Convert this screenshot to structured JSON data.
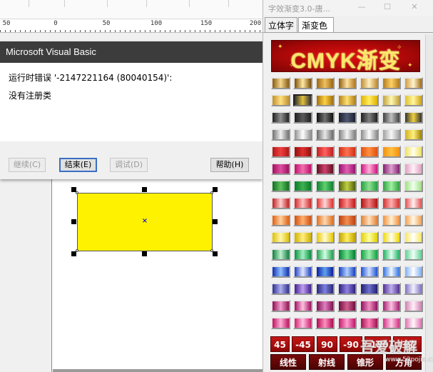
{
  "ruler": {
    "labels": [
      "50",
      "0",
      "50",
      "100",
      "150",
      "200"
    ]
  },
  "vb_dialog": {
    "title": "Microsoft Visual Basic",
    "error_line": "运行时错误 '-2147221164 (80040154)':",
    "error_detail": "没有注册类",
    "buttons": {
      "continue": "继续(C)",
      "end": "结束(E)",
      "debug": "调试(D)",
      "help": "帮助(H)"
    }
  },
  "panel": {
    "title": "字效渐变3.0-唐...",
    "window_controls": {
      "minimize": "—",
      "maximize": "☐",
      "close": "✕"
    },
    "tabs": [
      "立体字",
      "渐变色"
    ],
    "active_tab": "渐变色",
    "banner": "CMYK渐变",
    "angle_buttons": [
      "45",
      "-45",
      "90",
      "-90",
      "-180",
      "归位"
    ],
    "type_buttons": [
      "线性",
      "射线",
      "锥形",
      "方角"
    ]
  },
  "watermark": {
    "text": "吾爱破解",
    "url": "www.52pojie.cn"
  },
  "colors": {
    "selection_fill": "#fff200",
    "vb_titlebar": "#3c3c3c",
    "banner_red": "#c01010",
    "button_red": "#b00d0d"
  },
  "swatch_rows": [
    [
      [
        "#8a5a10",
        "#f5d890",
        "#8a5a10"
      ],
      [
        "#7a4d08",
        "#ffe9a0",
        "#7a4d08"
      ],
      [
        "#9a6612",
        "#f0c060",
        "#9a6612"
      ],
      [
        "#8a5a10",
        "#ffe2a0",
        "#b07820"
      ],
      [
        "#c08a30",
        "#fff0c0",
        "#c08a30"
      ],
      [
        "#b07a20",
        "#ffd060",
        "#b07a20"
      ],
      [
        "#d09a40",
        "#fff5d0",
        "#a06a10"
      ]
    ],
    [
      [
        "#c09030",
        "#ffe080",
        "#c09030"
      ],
      [
        "#303030",
        "#e0c040",
        "#303030"
      ],
      [
        "#a07010",
        "#ffd040",
        "#a07010"
      ],
      [
        "#b08020",
        "#ffe070",
        "#b08020"
      ],
      [
        "#e0b000",
        "#ffee60",
        "#e0b000"
      ],
      [
        "#c0a040",
        "#fff8b0",
        "#c0a040"
      ],
      [
        "#e0c030",
        "#fff6a0",
        "#d0a010"
      ]
    ],
    [
      [
        "#202020",
        "#909090",
        "#202020"
      ],
      [
        "#202020",
        "#5a5a5a",
        "#202020"
      ],
      [
        "#101010",
        "#707070",
        "#101010"
      ],
      [
        "#1a2030",
        "#505870",
        "#1a2030"
      ],
      [
        "#202020",
        "#808080",
        "#202020"
      ],
      [
        "#404040",
        "#c0c0c0",
        "#404040"
      ],
      [
        "#303030",
        "#f0d040",
        "#303030"
      ]
    ],
    [
      [
        "#707070",
        "#f0f0f0",
        "#707070"
      ],
      [
        "#909090",
        "#ffffff",
        "#909090"
      ],
      [
        "#6a6a6a",
        "#e8e8e8",
        "#6a6a6a"
      ],
      [
        "#808080",
        "#f4f4f4",
        "#808080"
      ],
      [
        "#8a8a8a",
        "#ffffff",
        "#8a8a8a"
      ],
      [
        "#a0a0a0",
        "#f8f8f8",
        "#a0a0a0"
      ],
      [
        "#d0b020",
        "#fff080",
        "#a08000"
      ]
    ],
    [
      [
        "#b01818",
        "#f04040",
        "#b01818"
      ],
      [
        "#901010",
        "#e03030",
        "#901010"
      ],
      [
        "#c02020",
        "#ff6060",
        "#c02020"
      ],
      [
        "#d03018",
        "#ff7050",
        "#d03018"
      ],
      [
        "#e05010",
        "#ff9040",
        "#e05010"
      ],
      [
        "#f09010",
        "#ffc040",
        "#f09010"
      ],
      [
        "#f0e060",
        "#fffff0",
        "#f0e060"
      ]
    ],
    [
      [
        "#a01060",
        "#e050a0",
        "#a01060"
      ],
      [
        "#c0106a",
        "#f070b0",
        "#c0106a"
      ],
      [
        "#601020",
        "#d04070",
        "#601020"
      ],
      [
        "#9a1070",
        "#e060b0",
        "#9a1070"
      ],
      [
        "#d01080",
        "#ffb0d8",
        "#d01080"
      ],
      [
        "#802070",
        "#e0a0d0",
        "#802070"
      ],
      [
        "#e0a0c0",
        "#fff0f8",
        "#e0a0c0"
      ]
    ],
    [
      [
        "#107020",
        "#60c060",
        "#107020"
      ],
      [
        "#0a7a2a",
        "#40b050",
        "#0a7a2a"
      ],
      [
        "#108030",
        "#60d070",
        "#108030"
      ],
      [
        "#506010",
        "#c0d040",
        "#506010"
      ],
      [
        "#20a040",
        "#90e090",
        "#20a040"
      ],
      [
        "#30a040",
        "#a0f0a0",
        "#30a040"
      ],
      [
        "#a0e080",
        "#f0fff0",
        "#a0e080"
      ]
    ],
    [
      [
        "#c02020",
        "#ffd0d0",
        "#c02020"
      ],
      [
        "#d02828",
        "#ffc0c0",
        "#d02828"
      ],
      [
        "#e03030",
        "#ffd8d8",
        "#e03030"
      ],
      [
        "#c01818",
        "#ff9090",
        "#c01818"
      ],
      [
        "#b01010",
        "#f08080",
        "#b01010"
      ],
      [
        "#d03030",
        "#ffb0b0",
        "#d03030"
      ],
      [
        "#e05050",
        "#fff0f0",
        "#e05050"
      ]
    ],
    [
      [
        "#e06010",
        "#ffd0a0",
        "#e06010"
      ],
      [
        "#d05010",
        "#ffb070",
        "#d05010"
      ],
      [
        "#e07020",
        "#ffd8b0",
        "#e07020"
      ],
      [
        "#c04010",
        "#f09050",
        "#c04010"
      ],
      [
        "#e08030",
        "#ffe0c0",
        "#e08030"
      ],
      [
        "#f09040",
        "#fff0d0",
        "#f09040"
      ],
      [
        "#f0a050",
        "#fff8e8",
        "#f0a050"
      ]
    ],
    [
      [
        "#e0c000",
        "#fff8b0",
        "#e0c000"
      ],
      [
        "#d0b000",
        "#ffee80",
        "#d0b000"
      ],
      [
        "#e8c800",
        "#fffbd0",
        "#e8c800"
      ],
      [
        "#c0a000",
        "#fff060",
        "#c0a000"
      ],
      [
        "#e0d000",
        "#ffffa0",
        "#e0d000"
      ],
      [
        "#f0d800",
        "#fffff0",
        "#f0d800"
      ],
      [
        "#f8e860",
        "#ffffff",
        "#f8e860"
      ]
    ],
    [
      [
        "#108040",
        "#c0f0d0",
        "#108040"
      ],
      [
        "#0a9040",
        "#a0f0c0",
        "#0a9040"
      ],
      [
        "#20a050",
        "#d0ffe0",
        "#20a050"
      ],
      [
        "#008030",
        "#70e090",
        "#008030"
      ],
      [
        "#10a040",
        "#a0f0b0",
        "#10a040"
      ],
      [
        "#20b060",
        "#e0fff0",
        "#20b060"
      ],
      [
        "#60d090",
        "#f0fff8",
        "#60d090"
      ]
    ],
    [
      [
        "#1030b0",
        "#90c0ff",
        "#1030b0"
      ],
      [
        "#2040c0",
        "#e0e8ff",
        "#2040c0"
      ],
      [
        "#0a20a0",
        "#60a0f0",
        "#0a20a0"
      ],
      [
        "#1840c0",
        "#b0d0ff",
        "#1840c0"
      ],
      [
        "#2050d0",
        "#d0e0ff",
        "#2050d0"
      ],
      [
        "#3070e0",
        "#f0f8ff",
        "#3070e0"
      ],
      [
        "#80b0f0",
        "#ffffff",
        "#80b0f0"
      ]
    ],
    [
      [
        "#303090",
        "#b0b0f0",
        "#303090"
      ],
      [
        "#402090",
        "#c0a0f0",
        "#402090"
      ],
      [
        "#282878",
        "#8080e0",
        "#282878"
      ],
      [
        "#302080",
        "#9080e0",
        "#302080"
      ],
      [
        "#202070",
        "#7070d0",
        "#202070"
      ],
      [
        "#503090",
        "#c0b0f0",
        "#503090"
      ],
      [
        "#8070c0",
        "#f0f0ff",
        "#8070c0"
      ]
    ],
    [
      [
        "#901050",
        "#f0a0d0",
        "#901050"
      ],
      [
        "#a01060",
        "#ffc0e0",
        "#a01060"
      ],
      [
        "#801050",
        "#e080c0",
        "#801050"
      ],
      [
        "#701040",
        "#d06090",
        "#701040"
      ],
      [
        "#901060",
        "#f090c0",
        "#901060"
      ],
      [
        "#a02070",
        "#ffc0e0",
        "#a02070"
      ],
      [
        "#d080b0",
        "#fff0f8",
        "#d080b0"
      ]
    ],
    [
      [
        "#c01060",
        "#ffb0d8",
        "#c01060"
      ],
      [
        "#d02070",
        "#ffc0e0",
        "#d02070"
      ],
      [
        "#b00a50",
        "#ff90c0",
        "#b00a50"
      ],
      [
        "#c01868",
        "#ffa0d0",
        "#c01868"
      ],
      [
        "#a01050",
        "#ff80b8",
        "#a01050"
      ],
      [
        "#d03080",
        "#ffd0e8",
        "#d03080"
      ],
      [
        "#e070b0",
        "#fff8fc",
        "#e070b0"
      ]
    ]
  ],
  "selected_swatch": {
    "row": 1,
    "col": 1
  }
}
